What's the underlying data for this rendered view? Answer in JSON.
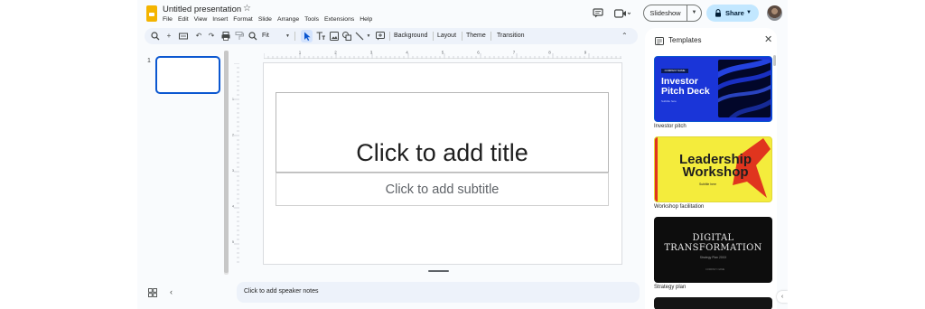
{
  "header": {
    "doc_title": "Untitled presentation",
    "menu": [
      "File",
      "Edit",
      "View",
      "Insert",
      "Format",
      "Slide",
      "Arrange",
      "Tools",
      "Extensions",
      "Help"
    ],
    "slideshow_label": "Slideshow",
    "share_label": "Share"
  },
  "toolbar": {
    "zoom": "Fit",
    "background": "Background",
    "layout": "Layout",
    "theme": "Theme",
    "transition": "Transition"
  },
  "filmstrip": {
    "slide_number": "1"
  },
  "slide": {
    "title_placeholder": "Click to add title",
    "subtitle_placeholder": "Click to add subtitle"
  },
  "notes": {
    "placeholder": "Click to add speaker notes"
  },
  "ruler": {
    "h_labels": [
      "1",
      "2",
      "3",
      "4",
      "5",
      "6",
      "7",
      "8",
      "9"
    ],
    "v_labels": [
      "1",
      "2",
      "3",
      "4",
      "5"
    ]
  },
  "templates": {
    "title": "Templates",
    "items": [
      {
        "caption": "Investor pitch",
        "title": "Investor Pitch Deck",
        "badge": "COMPANY NAME",
        "subtitle": "Subtitle here",
        "accent": "#1a35d8"
      },
      {
        "caption": "Workshop facilitation",
        "title": "Leadership Workshop",
        "subtitle": "Subtitle here",
        "accent": "#f4ec3c"
      },
      {
        "caption": "Strategy plan",
        "title": "DIGITAL TRANSFORMATION",
        "subtitle": "Strategy Plan 20XX",
        "tag": "COMPANY NAME",
        "accent": "#0d0d0d"
      }
    ]
  },
  "colors": {
    "accent_blue": "#0b57d0",
    "share_bg": "#c2e7ff",
    "toolbar_bg": "#edf2fa"
  }
}
